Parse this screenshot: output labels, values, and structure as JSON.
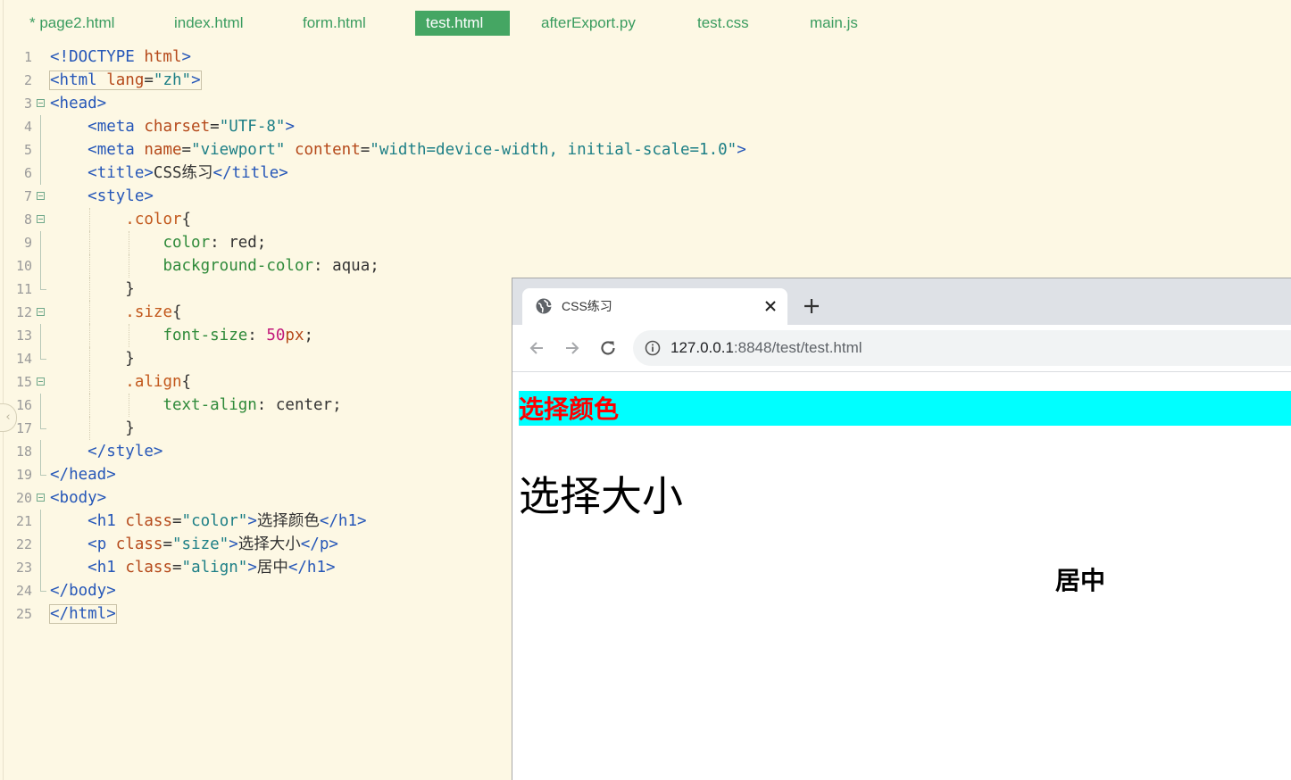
{
  "editor": {
    "tabs": [
      {
        "label": "* page2.html"
      },
      {
        "label": "index.html"
      },
      {
        "label": "form.html"
      },
      {
        "label": "test.html",
        "active": true
      },
      {
        "label": "afterExport.py"
      },
      {
        "label": "test.css"
      },
      {
        "label": "main.js"
      }
    ],
    "lines": [
      {
        "n": "1",
        "tokens": [
          [
            "tag",
            "<!DOCTYPE "
          ],
          [
            "kw",
            "html"
          ],
          [
            "tag",
            ">"
          ]
        ]
      },
      {
        "n": "2",
        "tokens": [
          [
            "tag",
            "<html "
          ],
          [
            "attr",
            "lang"
          ],
          [
            "plain",
            "="
          ],
          [
            "str",
            "\"zh\""
          ],
          [
            "tag",
            ">"
          ]
        ]
      },
      {
        "n": "3",
        "tokens": [
          [
            "tag",
            "<head>"
          ]
        ]
      },
      {
        "n": "4",
        "tokens": [
          [
            "plain",
            "    "
          ],
          [
            "tag",
            "<meta "
          ],
          [
            "attr",
            "charset"
          ],
          [
            "plain",
            "="
          ],
          [
            "str",
            "\"UTF-8\""
          ],
          [
            "tag",
            ">"
          ]
        ]
      },
      {
        "n": "5",
        "tokens": [
          [
            "plain",
            "    "
          ],
          [
            "tag",
            "<meta "
          ],
          [
            "attr",
            "name"
          ],
          [
            "plain",
            "="
          ],
          [
            "str",
            "\"viewport\""
          ],
          [
            "plain",
            " "
          ],
          [
            "attr",
            "content"
          ],
          [
            "plain",
            "="
          ],
          [
            "str",
            "\"width=device-width, initial-scale=1.0\""
          ],
          [
            "tag",
            ">"
          ]
        ]
      },
      {
        "n": "6",
        "tokens": [
          [
            "plain",
            "    "
          ],
          [
            "tag",
            "<title>"
          ],
          [
            "plain",
            "CSS练习"
          ],
          [
            "tag",
            "</title>"
          ]
        ]
      },
      {
        "n": "7",
        "tokens": [
          [
            "plain",
            "    "
          ],
          [
            "tag",
            "<style>"
          ]
        ]
      },
      {
        "n": "8",
        "tokens": [
          [
            "plain",
            "        "
          ],
          [
            "sel",
            ".color"
          ],
          [
            "plain",
            "{"
          ]
        ]
      },
      {
        "n": "9",
        "tokens": [
          [
            "plain",
            "            "
          ],
          [
            "prop",
            "color"
          ],
          [
            "plain",
            ": red;"
          ]
        ]
      },
      {
        "n": "10",
        "tokens": [
          [
            "plain",
            "            "
          ],
          [
            "prop",
            "background-color"
          ],
          [
            "plain",
            ": aqua;"
          ]
        ]
      },
      {
        "n": "11",
        "tokens": [
          [
            "plain",
            "        }"
          ]
        ]
      },
      {
        "n": "12",
        "tokens": [
          [
            "plain",
            "        "
          ],
          [
            "sel",
            ".size"
          ],
          [
            "plain",
            "{"
          ]
        ]
      },
      {
        "n": "13",
        "tokens": [
          [
            "plain",
            "            "
          ],
          [
            "prop",
            "font-size"
          ],
          [
            "plain",
            ": "
          ],
          [
            "num",
            "50"
          ],
          [
            "unit",
            "px"
          ],
          [
            "plain",
            ";"
          ]
        ]
      },
      {
        "n": "14",
        "tokens": [
          [
            "plain",
            "        }"
          ]
        ]
      },
      {
        "n": "15",
        "tokens": [
          [
            "plain",
            "        "
          ],
          [
            "sel",
            ".align"
          ],
          [
            "plain",
            "{"
          ]
        ]
      },
      {
        "n": "16",
        "tokens": [
          [
            "plain",
            "            "
          ],
          [
            "prop",
            "text-align"
          ],
          [
            "plain",
            ": center;"
          ]
        ]
      },
      {
        "n": "17",
        "tokens": [
          [
            "plain",
            "        }"
          ]
        ]
      },
      {
        "n": "18",
        "tokens": [
          [
            "plain",
            "    "
          ],
          [
            "tag",
            "</style>"
          ]
        ]
      },
      {
        "n": "19",
        "tokens": [
          [
            "tag",
            "</head>"
          ]
        ]
      },
      {
        "n": "20",
        "tokens": [
          [
            "tag",
            "<body>"
          ]
        ]
      },
      {
        "n": "21",
        "tokens": [
          [
            "plain",
            "    "
          ],
          [
            "tag",
            "<h1 "
          ],
          [
            "attr",
            "class"
          ],
          [
            "plain",
            "="
          ],
          [
            "str",
            "\"color\""
          ],
          [
            "tag",
            ">"
          ],
          [
            "plain",
            "选择颜色"
          ],
          [
            "tag",
            "</h1>"
          ]
        ]
      },
      {
        "n": "22",
        "tokens": [
          [
            "plain",
            "    "
          ],
          [
            "tag",
            "<p "
          ],
          [
            "attr",
            "class"
          ],
          [
            "plain",
            "="
          ],
          [
            "str",
            "\"size\""
          ],
          [
            "tag",
            ">"
          ],
          [
            "plain",
            "选择大小"
          ],
          [
            "tag",
            "</p>"
          ]
        ]
      },
      {
        "n": "23",
        "tokens": [
          [
            "plain",
            "    "
          ],
          [
            "tag",
            "<h1 "
          ],
          [
            "attr",
            "class"
          ],
          [
            "plain",
            "="
          ],
          [
            "str",
            "\"align\""
          ],
          [
            "tag",
            ">"
          ],
          [
            "plain",
            "居中"
          ],
          [
            "tag",
            "</h1>"
          ]
        ]
      },
      {
        "n": "24",
        "tokens": [
          [
            "tag",
            "</body>"
          ]
        ]
      },
      {
        "n": "25",
        "tokens": [
          [
            "tag",
            "</html>"
          ]
        ]
      }
    ]
  },
  "browser": {
    "tab_title": "CSS练习",
    "url_host": "127.0.0.1",
    "url_path": ":8848/test/test.html",
    "page": {
      "h1_color": "选择颜色",
      "p_size": "选择大小",
      "h1_align": "居中"
    }
  }
}
